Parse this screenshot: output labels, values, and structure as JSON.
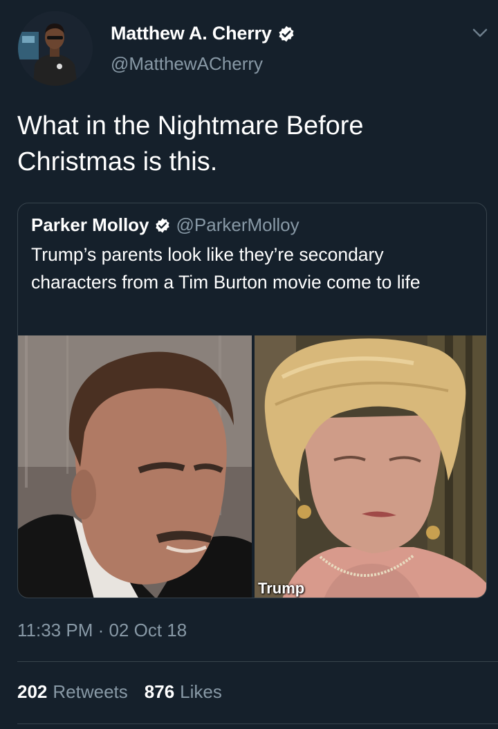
{
  "author": {
    "display_name": "Matthew A. Cherry",
    "handle": "@MatthewACherry",
    "verified": true
  },
  "tweet": {
    "text": "What in the Nightmare Before Christmas is this.",
    "timestamp": "11:33 PM · 02 Oct 18"
  },
  "quoted_tweet": {
    "display_name": "Parker Molloy",
    "handle": "@ParkerMolloy",
    "verified": true,
    "text": "Trump’s parents look like they’re secondary characters from a Tim Burton movie come to life",
    "media": {
      "left_photo": "man-portrait",
      "right_photo": "woman-portrait",
      "right_photo_caption": "Trump"
    }
  },
  "stats": {
    "retweets_count": "202",
    "retweets_label": "Retweets",
    "likes_count": "876",
    "likes_label": "Likes"
  },
  "colors": {
    "background": "#15202b",
    "primary_text": "#ffffff",
    "secondary_text": "#8899a6",
    "border": "#38444d"
  },
  "icons": [
    "verified-badge-icon",
    "chevron-down-icon"
  ]
}
